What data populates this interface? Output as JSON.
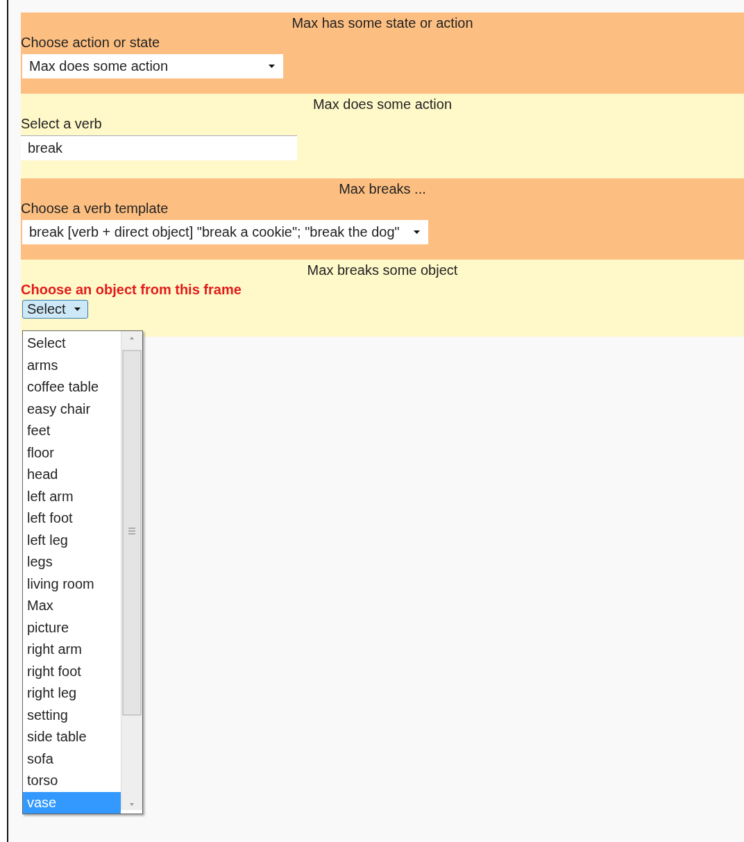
{
  "sections": [
    {
      "heading": "Max has some state or action",
      "color": "#fdbf81",
      "label": "Choose action or state",
      "highlighted": false,
      "kind": "dropdown",
      "value": "Max does some action"
    },
    {
      "heading": "Max does some action",
      "color": "#fff8c8",
      "label": "Select a verb",
      "highlighted": false,
      "kind": "textbox",
      "value": "break"
    },
    {
      "heading": "Max breaks ...",
      "color": "#fdbf81",
      "label": "Choose a verb template",
      "highlighted": false,
      "kind": "dropdown",
      "value": "break [verb + direct object] \"break a cookie\"; \"break the dog\""
    },
    {
      "heading": "Max breaks some object",
      "color": "#fff8c8",
      "label": "Choose an object from this frame",
      "highlighted": true,
      "kind": "open_dropdown",
      "value": "Select",
      "options": [
        {
          "label": "Select",
          "highlighted": false
        },
        {
          "label": "arms",
          "highlighted": false
        },
        {
          "label": "coffee table",
          "highlighted": false
        },
        {
          "label": "easy chair",
          "highlighted": false
        },
        {
          "label": "feet",
          "highlighted": false
        },
        {
          "label": "floor",
          "highlighted": false
        },
        {
          "label": "head",
          "highlighted": false
        },
        {
          "label": "left arm",
          "highlighted": false
        },
        {
          "label": "left foot",
          "highlighted": false
        },
        {
          "label": "left leg",
          "highlighted": false
        },
        {
          "label": "legs",
          "highlighted": false
        },
        {
          "label": "living room",
          "highlighted": false
        },
        {
          "label": "Max",
          "highlighted": false
        },
        {
          "label": "picture",
          "highlighted": false
        },
        {
          "label": "right arm",
          "highlighted": false
        },
        {
          "label": "right foot",
          "highlighted": false
        },
        {
          "label": "right leg",
          "highlighted": false
        },
        {
          "label": "setting",
          "highlighted": false
        },
        {
          "label": "side table",
          "highlighted": false
        },
        {
          "label": "sofa",
          "highlighted": false
        },
        {
          "label": "torso",
          "highlighted": false
        },
        {
          "label": "vase",
          "highlighted": true
        }
      ]
    }
  ]
}
